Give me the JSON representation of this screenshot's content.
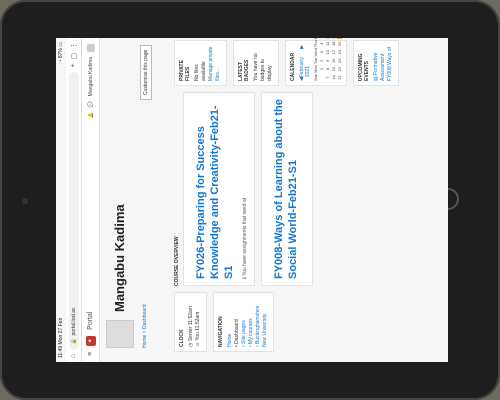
{
  "status": {
    "time": "11:49",
    "date": "Mon 27 Feb",
    "battery": "87%"
  },
  "browser": {
    "url": "portal.lsst.ac",
    "lock_icon": "lock-icon"
  },
  "navbar": {
    "brand": "Portal",
    "user": "Mangabu Kadima"
  },
  "profile": {
    "name": "Mangabu Kadima",
    "breadcrumb": "Home  >  Dashboard",
    "customise": "Customise this page"
  },
  "clock": {
    "title": "CLOCK",
    "rows": [
      {
        "label": "Server",
        "time": "11:52am"
      },
      {
        "label": "You",
        "time": "11:52am"
      }
    ]
  },
  "navigation": {
    "title": "NAVIGATION",
    "items": [
      "Home",
      "Dashboard",
      "Site pages",
      "My courses",
      "Buckinghamshire New University"
    ]
  },
  "course_overview": {
    "title": "COURSE OVERVIEW",
    "courses": [
      {
        "name": "FY026-Preparing for Success Knowledge and Creativity-Feb21-S1",
        "notice": "You have assignments that need at"
      },
      {
        "name": "FY008-Ways of Learning about the Social World-Feb21-S1",
        "notice": ""
      }
    ]
  },
  "private_files": {
    "title": "PRIVATE FILES",
    "empty": "No files available",
    "manage": "Manage private files..."
  },
  "badges": {
    "title": "LATEST BADGES",
    "text": "You have no badges to display"
  },
  "calendar": {
    "title": "CALENDAR",
    "month": "February 2021",
    "days": [
      "Sun",
      "Mon",
      "Tue",
      "Wed",
      "Thu",
      "Fri",
      "Sat"
    ],
    "dates": [
      "",
      "1",
      "2",
      "3",
      "4",
      "5",
      "6",
      "7",
      "8",
      "9",
      "10",
      "11",
      "12",
      "13",
      "14",
      "15",
      "16",
      "17",
      "18",
      "19",
      "20",
      "21",
      "22",
      "23",
      "24",
      "25",
      "26",
      "27"
    ],
    "today": "26"
  },
  "upcoming": {
    "title": "UPCOMING EVENTS",
    "items": [
      "Formative Assessment FY008 Ways of"
    ]
  }
}
